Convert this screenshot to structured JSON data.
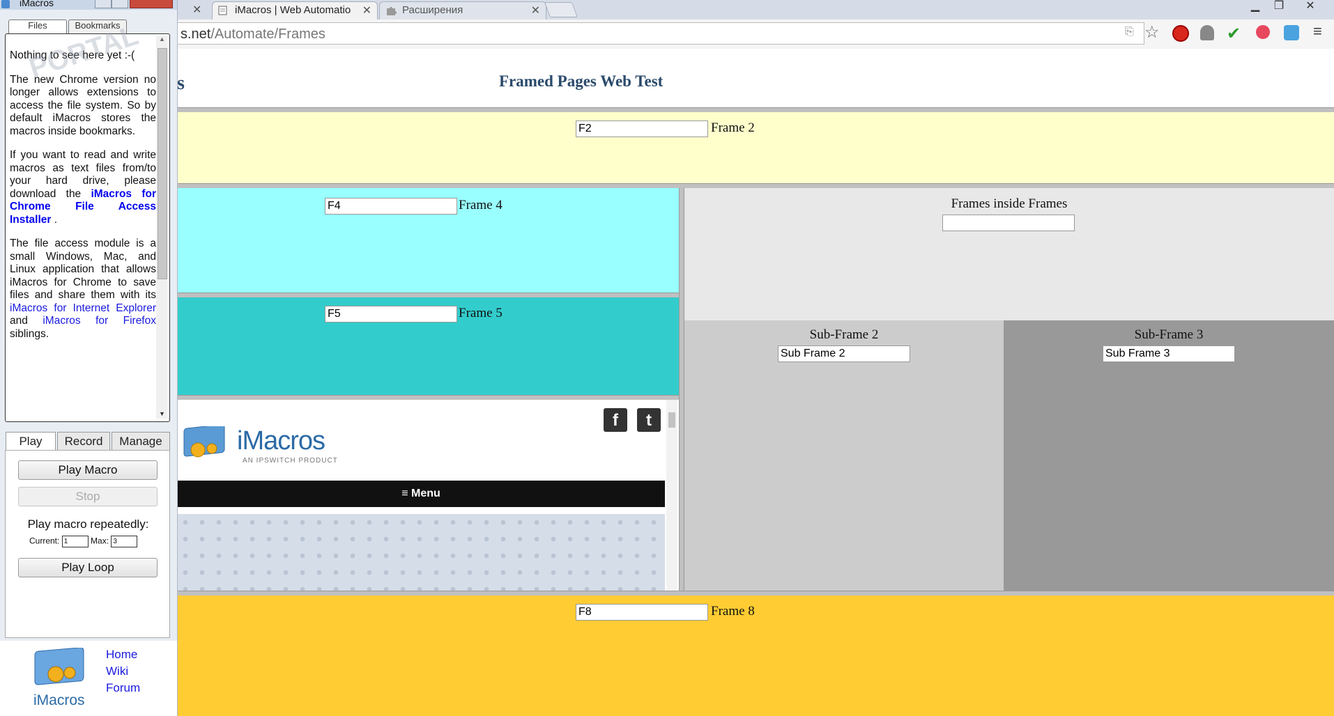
{
  "browser": {
    "tabs": [
      {
        "title": "iMacros | Web Automatio",
        "active": true
      },
      {
        "title": "Расширения",
        "active": false
      }
    ],
    "url_host_fragment": "s.net",
    "url_path": "/Automate/Frames"
  },
  "page": {
    "title": "Framed Pages Web Test",
    "partial_glyph": "s",
    "frame2": {
      "value": "F2",
      "label": "Frame 2"
    },
    "frame4": {
      "value": "F4",
      "label": "Frame 4"
    },
    "frame5": {
      "value": "F5",
      "label": "Frame 5"
    },
    "frames_inside": {
      "label": "Frames inside Frames",
      "value": ""
    },
    "subframe2": {
      "label": "Sub-Frame 2",
      "value": "Sub Frame 2"
    },
    "subframe3": {
      "label": "Sub-Frame 3",
      "value": "Sub Frame 3"
    },
    "frame8": {
      "value": "F8",
      "label": "Frame 8"
    },
    "embed": {
      "brand": "iMacros",
      "tagline": "AN IPSWITCH PRODUCT",
      "menu": "≡ Menu",
      "facebook": "f",
      "tumblr": "t"
    }
  },
  "colors": {
    "frame2_bg": "#ffffcc",
    "frame4_bg": "#99ffff",
    "frame5_bg": "#33cccc",
    "frames_inside_bg": "#e8e8e8",
    "subframe2_bg": "#cccccc",
    "subframe3_bg": "#999999",
    "frame8_bg": "#ffcc33"
  },
  "panel": {
    "title": "iMacros",
    "tabs": [
      "Files",
      "Bookmarks"
    ],
    "files_text": {
      "p1": "Nothing to see here yet :-(",
      "p2": "The new Chrome version no longer allows extensions to access the file system. So by default iMacros stores the macros inside bookmarks.",
      "p3_pre": "If you want to read and write macros as text files from/to your hard drive, please download the",
      "p3_link": "iMacros for Chrome File Access Installer",
      "p3_post": ".",
      "p4_pre": "The file access module is a small Windows, Mac, and Linux application that allows iMacros for Chrome to save files and share them with its",
      "p4_link1": "iMacros for Internet Explorer",
      "p4_and": "and",
      "p4_link2": "iMacros for Firefox",
      "p4_post": "siblings."
    },
    "mode_tabs": [
      "Play",
      "Record",
      "Manage"
    ],
    "play_macro": "Play Macro",
    "stop": "Stop",
    "repeat_label": "Play macro repeatedly:",
    "current_label": "Current:",
    "current_value": "1",
    "max_label": "Max:",
    "max_value": "3",
    "play_loop": "Play Loop",
    "footer_links": [
      "Home",
      "Wiki",
      "Forum"
    ],
    "footer_brand": "iMacros"
  }
}
